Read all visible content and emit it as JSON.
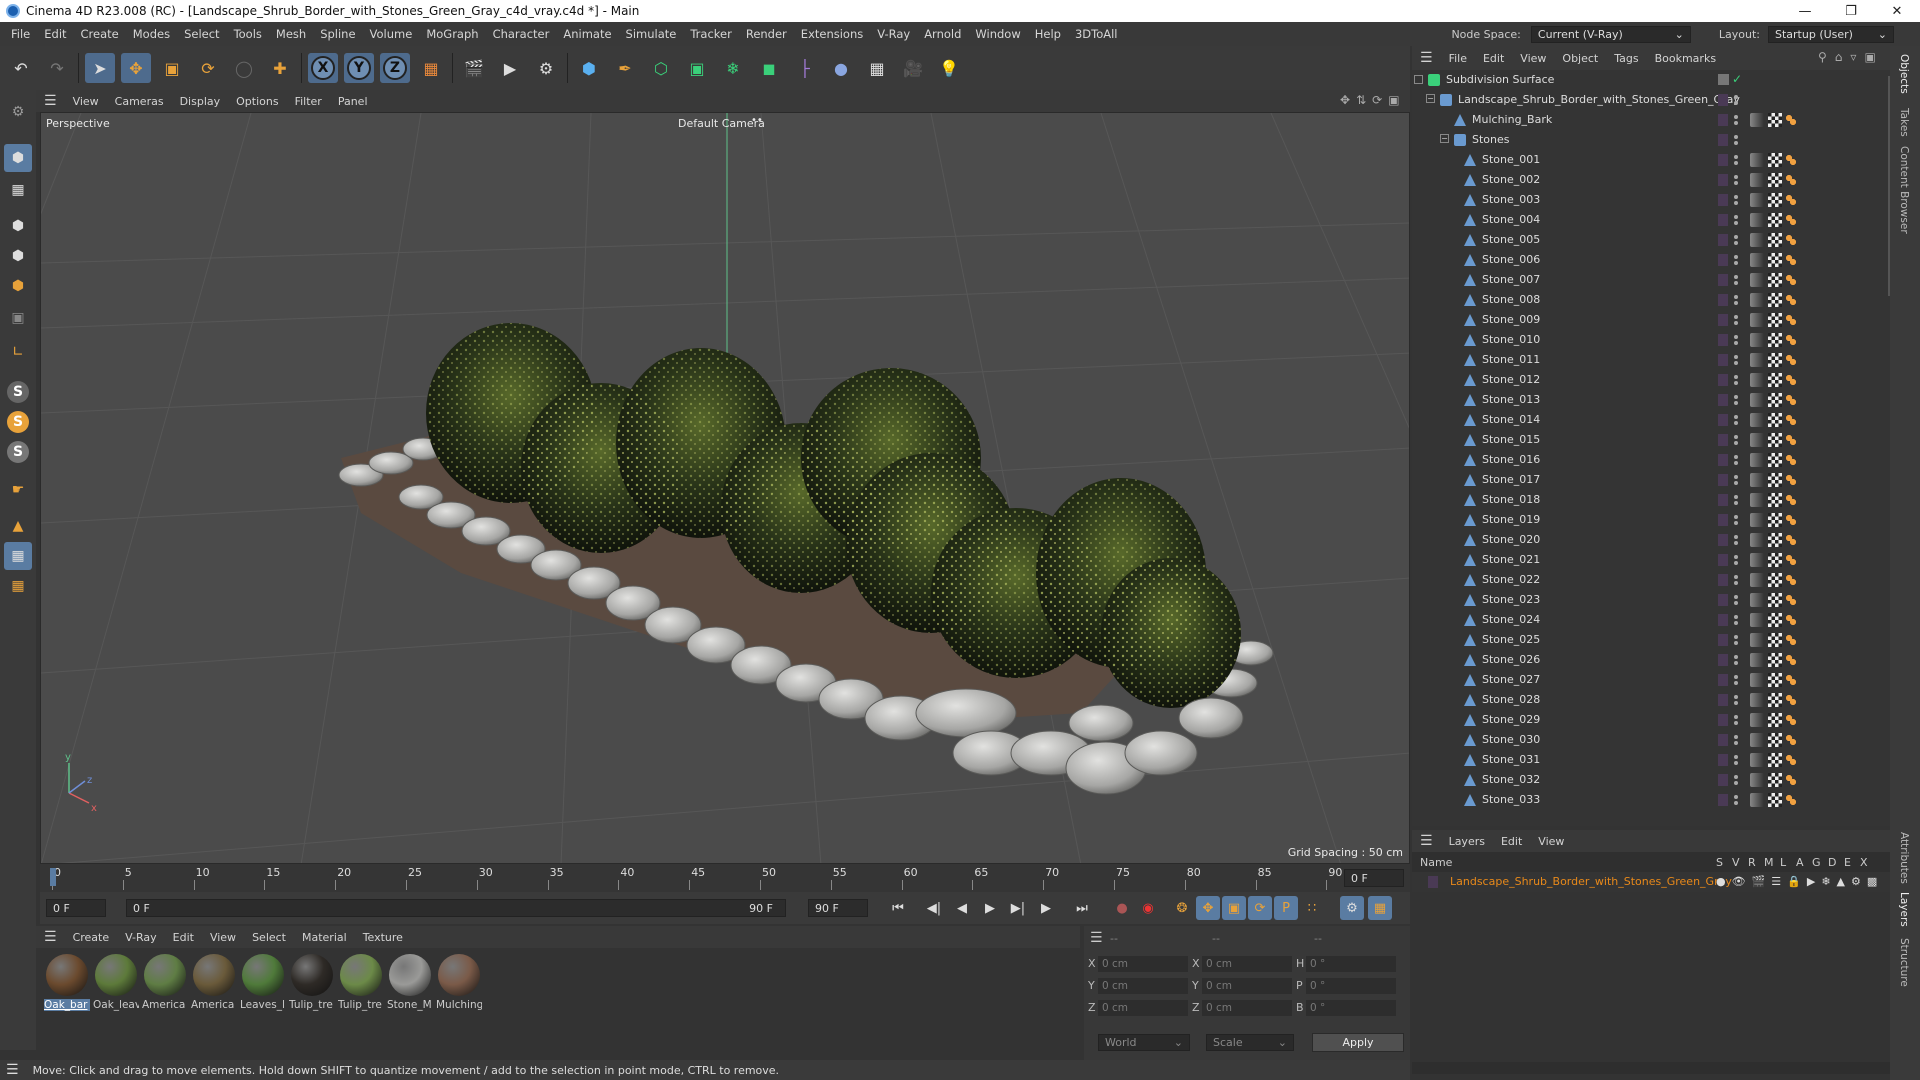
{
  "window": {
    "title": "Cinema 4D R23.008 (RC) - [Landscape_Shrub_Border_with_Stones_Green_Gray_c4d_vray.c4d *] - Main",
    "controls": [
      "—",
      "❐",
      "✕"
    ]
  },
  "menubar": {
    "items": [
      "File",
      "Edit",
      "Create",
      "Modes",
      "Select",
      "Tools",
      "Mesh",
      "Spline",
      "Volume",
      "MoGraph",
      "Character",
      "Animate",
      "Simulate",
      "Tracker",
      "Render",
      "Extensions",
      "V-Ray",
      "Arnold",
      "Window",
      "Help",
      "3DToAll"
    ],
    "node_space_label": "Node Space:",
    "node_space_value": "Current (V-Ray)",
    "layout_label": "Layout:",
    "layout_value": "Startup (User)"
  },
  "viewport": {
    "menu": [
      "View",
      "Cameras",
      "Display",
      "Options",
      "Filter",
      "Panel"
    ],
    "view_name": "Perspective",
    "camera": "Default Camera",
    "grid_spacing": "Grid Spacing : 50 cm"
  },
  "timeline": {
    "ticks": [
      "0",
      "5",
      "10",
      "15",
      "20",
      "25",
      "30",
      "35",
      "40",
      "45",
      "50",
      "55",
      "60",
      "65",
      "70",
      "75",
      "80",
      "85",
      "90"
    ],
    "current_frame": "0 F",
    "start_frame": "0 F",
    "range_start": "0 F",
    "range_end": "90 F",
    "end_frame": "90 F"
  },
  "materials": {
    "menu": [
      "Create",
      "V-Ray",
      "Edit",
      "View",
      "Select",
      "Material",
      "Texture"
    ],
    "items": [
      {
        "label": "Oak_bar",
        "color": "#6b4a2e"
      },
      {
        "label": "Oak_leav",
        "color": "#5d7a3a"
      },
      {
        "label": "America",
        "color": "#5f7d44"
      },
      {
        "label": "America",
        "color": "#6a5a3a"
      },
      {
        "label": "Leaves_l",
        "color": "#4f7a3a"
      },
      {
        "label": "Tulip_tre",
        "color": "#2e2a26"
      },
      {
        "label": "Tulip_tre",
        "color": "#6c8a48"
      },
      {
        "label": "Stone_M",
        "color": "#9a9a98"
      },
      {
        "label": "Mulching",
        "color": "#7a5a48"
      }
    ]
  },
  "coordinates": {
    "headers": [
      "--",
      "--",
      "--"
    ],
    "rows": [
      {
        "a": "X",
        "av": "0 cm",
        "b": "X",
        "bv": "0 cm",
        "c": "H",
        "cv": "0 °"
      },
      {
        "a": "Y",
        "av": "0 cm",
        "b": "Y",
        "bv": "0 cm",
        "c": "P",
        "cv": "0 °"
      },
      {
        "a": "Z",
        "av": "0 cm",
        "b": "Z",
        "bv": "0 cm",
        "c": "B",
        "cv": "0 °"
      }
    ],
    "mode1": "World",
    "mode2": "Scale",
    "apply": "Apply"
  },
  "status": "Move: Click and drag to move elements. Hold down SHIFT to quantize movement / add to the selection in point mode, CTRL to remove.",
  "objects": {
    "menu": [
      "File",
      "Edit",
      "View",
      "Object",
      "Tags",
      "Bookmarks"
    ],
    "root": "Subdivision Surface",
    "group": "Landscape_Shrub_Border_with_Stones_Green_Gray",
    "mulching": "Mulching_Bark",
    "stones_group": "Stones",
    "stones": [
      "Stone_001",
      "Stone_002",
      "Stone_003",
      "Stone_004",
      "Stone_005",
      "Stone_006",
      "Stone_007",
      "Stone_008",
      "Stone_009",
      "Stone_010",
      "Stone_011",
      "Stone_012",
      "Stone_013",
      "Stone_014",
      "Stone_015",
      "Stone_016",
      "Stone_017",
      "Stone_018",
      "Stone_019",
      "Stone_020",
      "Stone_021",
      "Stone_022",
      "Stone_023",
      "Stone_024",
      "Stone_025",
      "Stone_026",
      "Stone_027",
      "Stone_028",
      "Stone_029",
      "Stone_030",
      "Stone_031",
      "Stone_032",
      "Stone_033"
    ]
  },
  "layers": {
    "menu": [
      "Layers",
      "Edit",
      "View"
    ],
    "name_header": "Name",
    "flags": [
      "S",
      "V",
      "R",
      "M",
      "L",
      "A",
      "G",
      "D",
      "E",
      "X"
    ],
    "row": "Landscape_Shrub_Border_with_Stones_Green_Gray",
    "row_color": "#e8891a"
  },
  "side_tabs": [
    "Objects",
    "Takes",
    "Content Browser",
    "Attributes",
    "Layers",
    "Structure"
  ]
}
